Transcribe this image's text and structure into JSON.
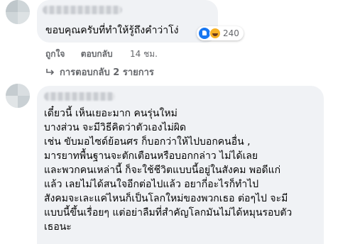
{
  "comment1": {
    "text": "ขอบคุณครับที่ทำให้รู้ถึงคำว่าโง่",
    "reaction_count": "240",
    "actions": {
      "like": "ถูกใจ",
      "reply": "ตอบกลับ",
      "time": "14 ชม."
    },
    "replies_label": "การตอบกลับ 2 รายการ"
  },
  "comment2": {
    "lines": [
      "เดี๋ยวนี้ เห็นเยอะมาก คนรุ่นใหม่",
      "บางส่วน จะมีวิธีคิดว่าตัวเองไม่ผิด",
      "เช่น ขับมอไซด์ย้อนศร ก็บอกว่าให้ไปบอกคนอื่น ,",
      "มารยาทพื้นฐานจะตักเตือนหรือบอกกล่าว ไม่ได้เลย",
      "และพวกคนเหล่านี้ ก็จะใช้ชีวิตแบบนี้อยู่ในสังคม พอดีแก่",
      "แล้ว เลยไม่ได้สนใจอีกต่อไปแล้ว อยากี่อะไรก็ทำไป",
      "สังคมจะเละแค่ไหนก็เป็นโลกใหม่ของพวกเธอ ต่อๆไป จะมี",
      "แบบนี้ขึ้นเรื่อยๆ แต่อย่าลืมที่สำคัญโลกมันไม่ได้หมุนรอบตัว",
      "เธอนะ"
    ]
  },
  "colors": {
    "bubble": "#f0f2f5",
    "meta": "#65676b",
    "like": "#1877f2",
    "haha": "#f7b125"
  },
  "icons": [
    "like-reaction-icon",
    "haha-reaction-icon",
    "reply-arrow-icon"
  ]
}
